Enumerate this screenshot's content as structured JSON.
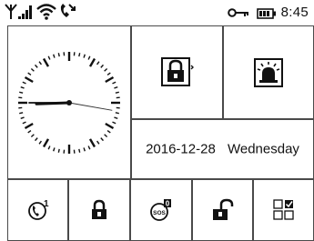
{
  "status_bar": {
    "icons": [
      "antenna-icon",
      "signal-strength-icon",
      "wifi-icon",
      "phone-connected-icon",
      "key-icon",
      "battery-icon"
    ],
    "time": "8:45"
  },
  "clock": {
    "type": "analog",
    "hour_hand_angle_deg": 268,
    "minute_hand_angle_deg": 270,
    "second_hand_angle_deg": 100
  },
  "info_tile": {
    "date": "2016-12-28",
    "weekday": "Wednesday"
  },
  "tiles": {
    "top": [
      {
        "icon": "arm-lock-icon"
      },
      {
        "icon": "siren-alarm-icon"
      }
    ],
    "bottom": [
      {
        "icon": "phone-call-icon",
        "badge": "1"
      },
      {
        "icon": "lock-closed-icon"
      },
      {
        "icon": "sos-icon",
        "badge": "0"
      },
      {
        "icon": "lock-open-icon"
      },
      {
        "icon": "checklist-grid-icon"
      }
    ]
  }
}
